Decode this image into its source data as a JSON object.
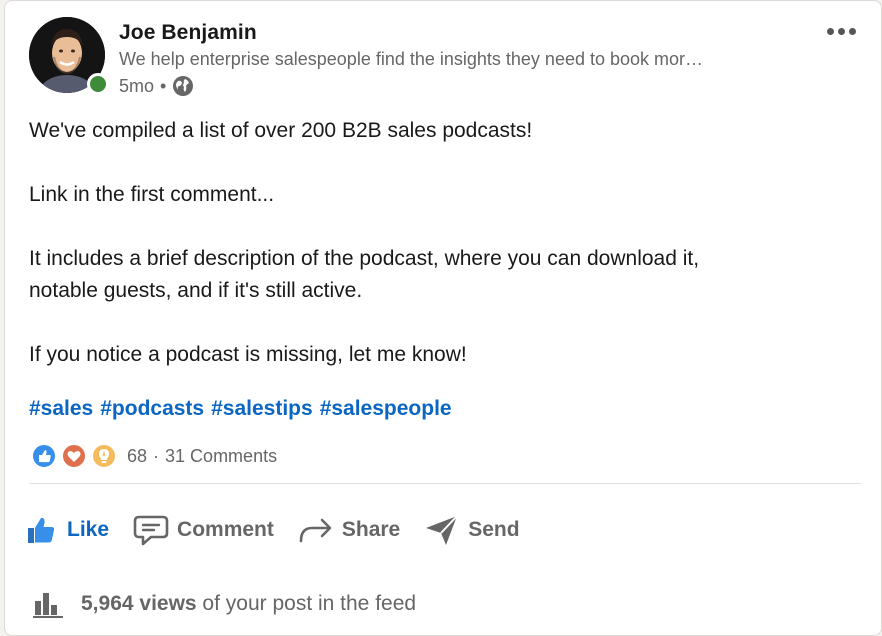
{
  "author": {
    "name": "Joe Benjamin",
    "headline": "We help enterprise salespeople find the insights they need to book mor…",
    "time": "5mo",
    "separator": "•",
    "visibility_icon": "globe-icon",
    "presence_color": "#3e8c3a"
  },
  "post": {
    "lines": [
      "We've compiled a list of over 200 B2B sales podcasts!",
      "Link in the first comment...",
      "It includes a brief description of the podcast, where you can download it,",
      "notable guests, and if it's still active.",
      "If you notice a podcast is missing, let me know!"
    ],
    "hashtags": [
      "#sales",
      "#podcasts",
      "#salestips",
      "#salespeople"
    ]
  },
  "social": {
    "reaction_icons": [
      "like-reaction-icon",
      "love-reaction-icon",
      "insightful-reaction-icon"
    ],
    "reaction_count": "68",
    "separator": "·",
    "comments": "31 Comments"
  },
  "actions": {
    "like": "Like",
    "comment": "Comment",
    "share": "Share",
    "send": "Send"
  },
  "views": {
    "count": "5,964 views",
    "suffix": " of your post in the feed"
  },
  "colors": {
    "accent": "#0a66c2",
    "muted": "#666666",
    "love": "#df704d",
    "insightful": "#f5bb5c"
  }
}
